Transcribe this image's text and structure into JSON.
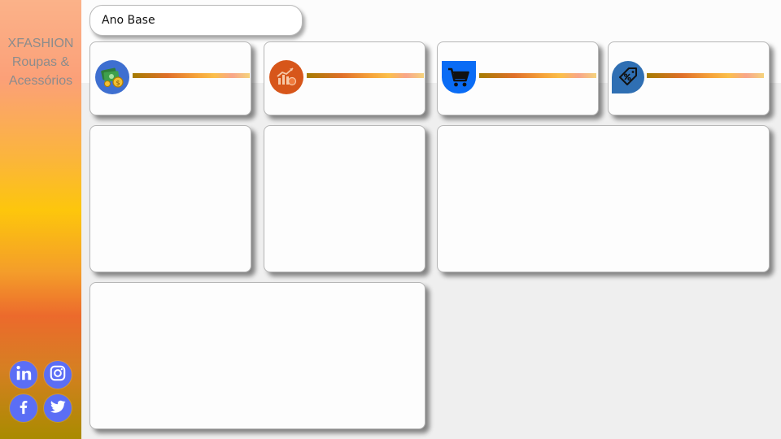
{
  "sidebar": {
    "brand_line1": "XFASHION",
    "brand_line2": "Roupas &",
    "brand_line3": "Acessórios",
    "social": [
      "linkedin-icon",
      "instagram-icon",
      "facebook-icon",
      "twitter-icon"
    ]
  },
  "filter": {
    "slicer_label": "Ano Base"
  },
  "kpis": [
    {
      "icon": "money-icon",
      "color": "#3e6fd0"
    },
    {
      "icon": "growth-chart-icon",
      "color": "#d7561a"
    },
    {
      "icon": "shopping-cart-icon",
      "color": "#0a6cf5"
    },
    {
      "icon": "discount-tag-icon",
      "color": "#2f6fb3"
    }
  ],
  "colors": {
    "social_button": "#5b6ef5",
    "background": "#efefef",
    "card": "#fdfdfd"
  }
}
